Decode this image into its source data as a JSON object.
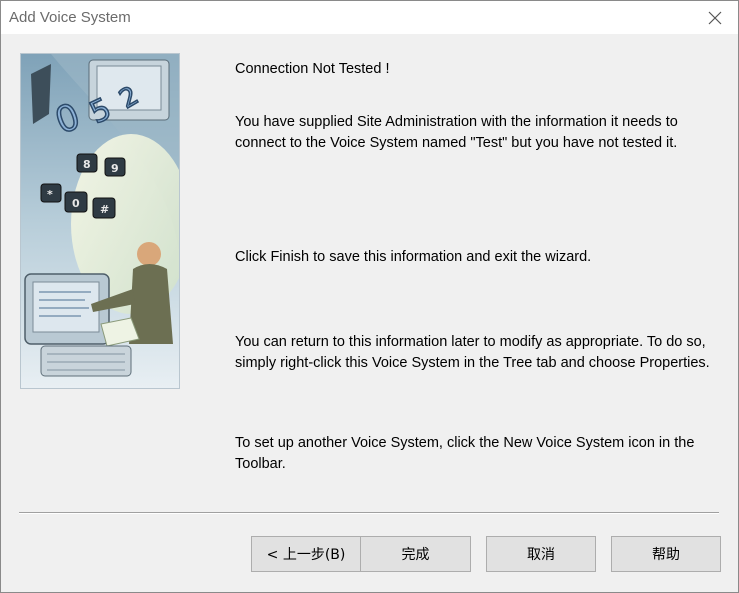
{
  "window": {
    "title": "Add Voice System",
    "close_icon": "close-icon"
  },
  "image": {
    "description_icon": "voice-system-wizard-illustration"
  },
  "content": {
    "heading": "Connection Not Tested !",
    "para1": "You have supplied Site Administration with the information it needs to connect to the Voice System named \"Test\" but you have not tested it.",
    "para2": "Click Finish to save this information and exit the wizard.",
    "para3": "You can return to this information later to modify as appropriate.  To do so, simply right-click this Voice System in the Tree tab and choose Properties.",
    "para4": "To set up another Voice System, click the New Voice System icon in the Toolbar."
  },
  "buttons": {
    "back": "< 上一步(B)",
    "finish": "完成",
    "cancel": "取消",
    "help": "帮助"
  }
}
